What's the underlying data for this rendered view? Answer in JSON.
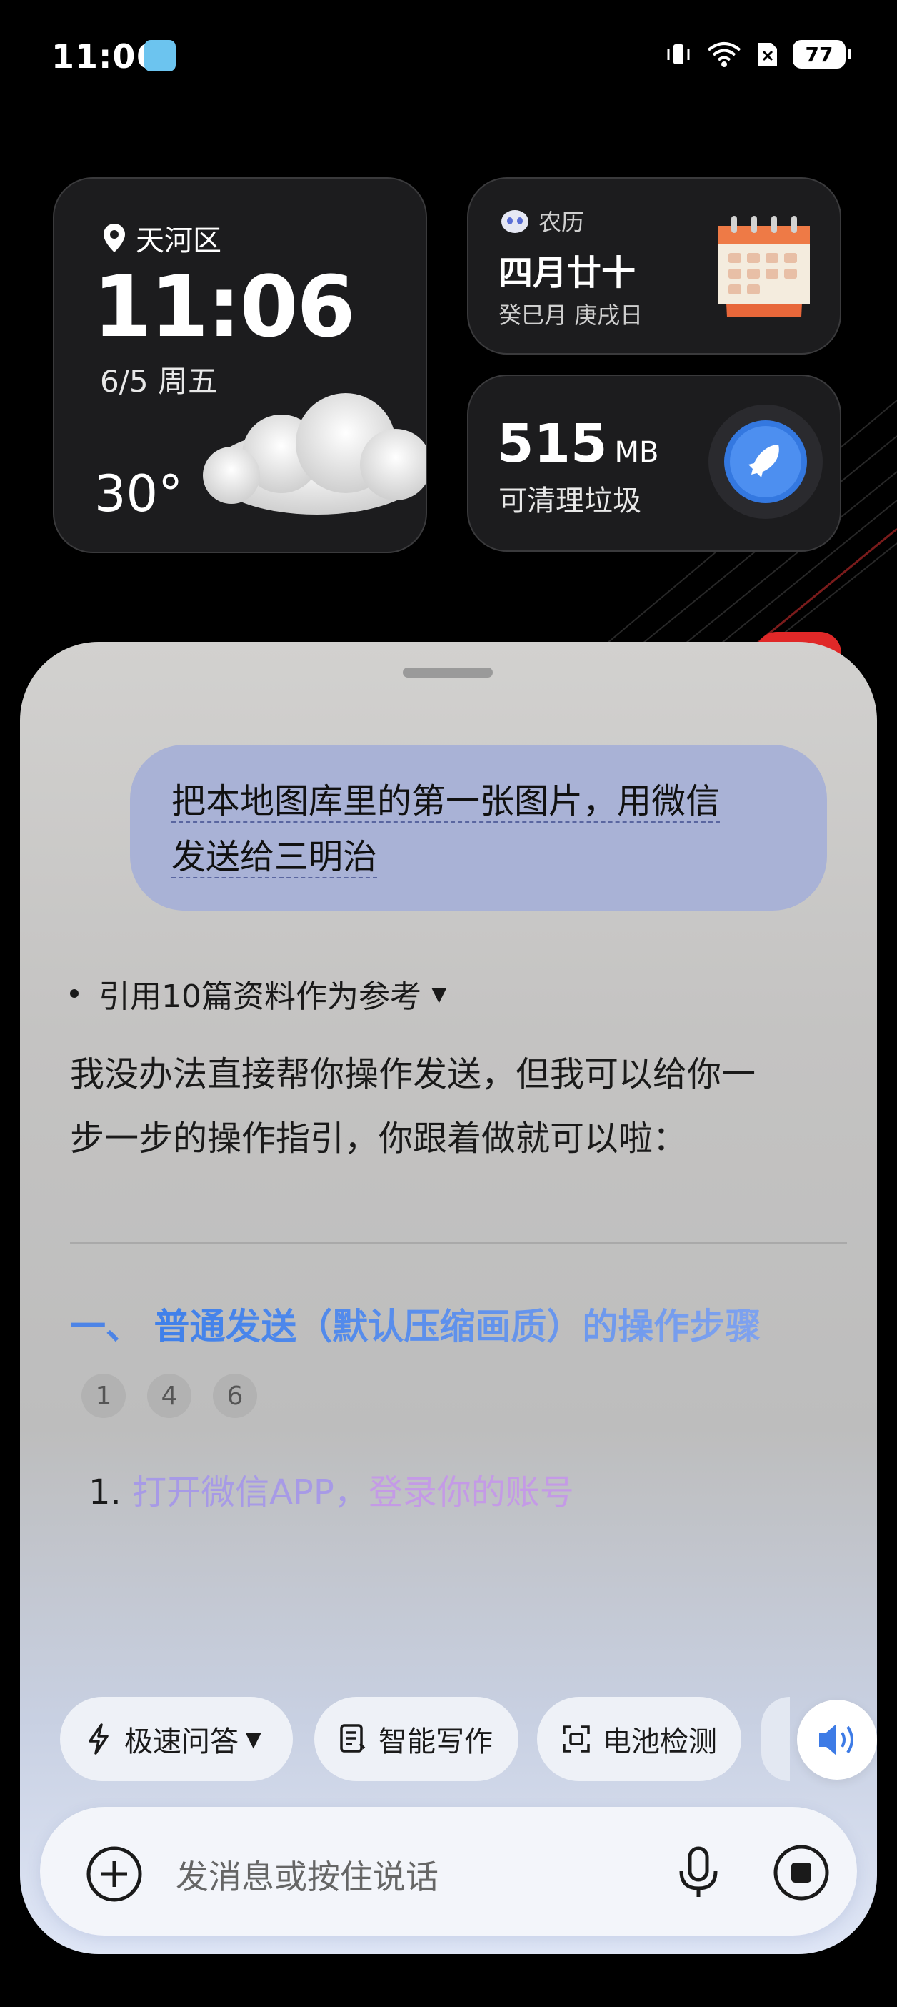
{
  "status_bar": {
    "time": "11:06",
    "battery": "77"
  },
  "weather_widget": {
    "location": "天河区",
    "time": "11:06",
    "date": "6/5 周五",
    "temperature": "30°"
  },
  "calendar_widget": {
    "label": "农历",
    "lunar_date": "四月廿十",
    "ganzhi": "癸巳月 庚戌日"
  },
  "cleaner_widget": {
    "amount": "515",
    "unit": "MB",
    "label": "可清理垃圾"
  },
  "chat": {
    "user_message_line1": "把本地图库里的第一张图片，用微信",
    "user_message_line2": "发送给三明治",
    "reference_text": "引用10篇资料作为参考",
    "answer_line1": "我没办法直接帮你操作发送，但我可以给你一",
    "answer_line2": "步一步的操作指引，你跟着做就可以啦：",
    "section_prefix": "一、",
    "section_title": "普通发送（默认压缩画质）的操作步骤",
    "citations": [
      "1",
      "4",
      "6"
    ],
    "step_number": "1.",
    "step_text_a": "打开微信APP，",
    "step_text_b": "登录你的账号"
  },
  "chips": {
    "fast_qa": "极速问答",
    "smart_write": "智能写作",
    "battery_check": "电池检测"
  },
  "input": {
    "placeholder": "发消息或按住说话"
  },
  "colors": {
    "accent": "#4d84e6",
    "bubble": "#a9b2d6",
    "panel": "#c4c3c2"
  }
}
